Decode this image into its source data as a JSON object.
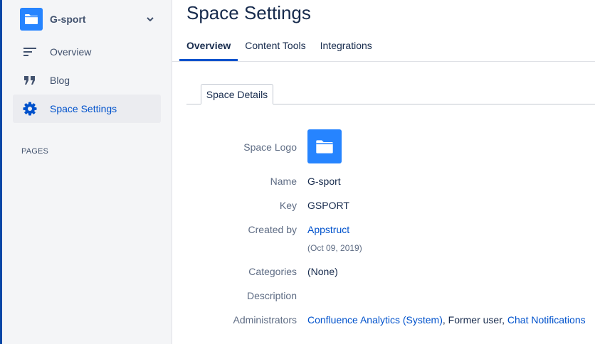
{
  "sidebar": {
    "space_name": "G-sport",
    "nav": [
      {
        "label": "Overview",
        "icon": "overview-icon"
      },
      {
        "label": "Blog",
        "icon": "quote-icon"
      },
      {
        "label": "Space Settings",
        "icon": "gear-icon"
      }
    ],
    "pages_heading": "PAGES"
  },
  "main": {
    "title": "Space Settings",
    "tabs": [
      "Overview",
      "Content Tools",
      "Integrations"
    ],
    "active_tab": "Overview",
    "subtab": "Space Details",
    "details": {
      "logo_label": "Space Logo",
      "name_label": "Name",
      "name_value": "G-sport",
      "key_label": "Key",
      "key_value": "GSPORT",
      "created_label": "Created by",
      "created_by": "Appstruct",
      "created_date": "(Oct 09, 2019)",
      "categories_label": "Categories",
      "categories_value": "(None)",
      "description_label": "Description",
      "administrators_label": "Administrators",
      "administrators": [
        "Confluence Analytics (System)",
        "Former user",
        "Chat Notifications"
      ],
      "separator": ", "
    }
  },
  "colors": {
    "accent": "#0052cc",
    "space_icon": "#2684ff",
    "sidebar_bg": "#f4f5f7",
    "left_stripe": "#0747a6"
  }
}
